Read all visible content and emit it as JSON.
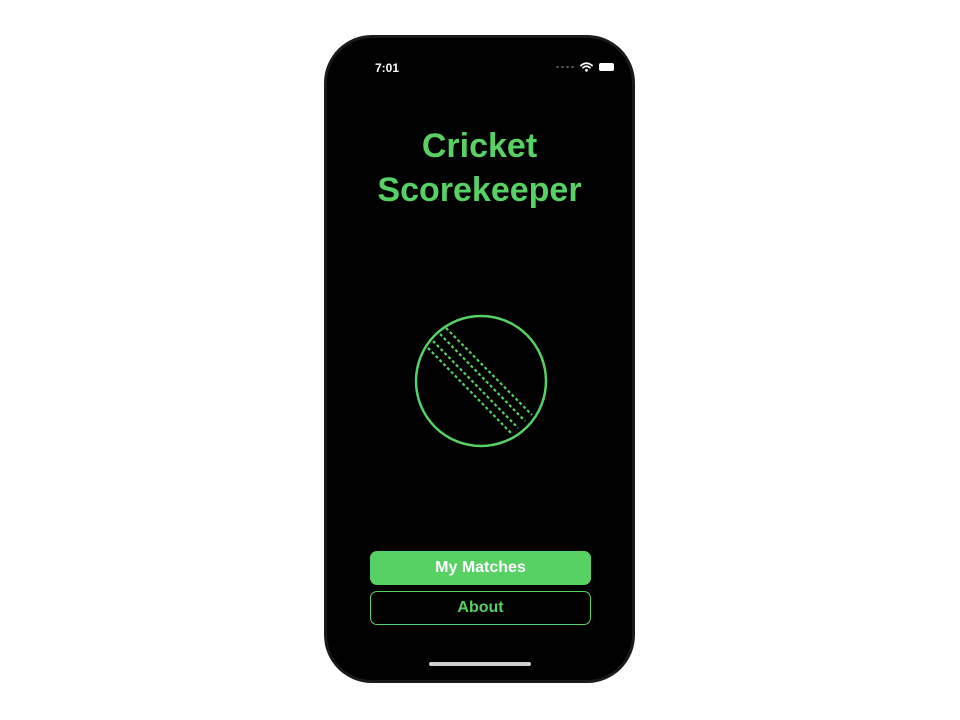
{
  "status_bar": {
    "time": "7:01"
  },
  "app": {
    "title_line1": "Cricket",
    "title_line2": "Scorekeeper",
    "accent_color": "#57d163",
    "logo_icon": "cricket-ball-icon"
  },
  "buttons": {
    "my_matches": "My Matches",
    "about": "About"
  }
}
